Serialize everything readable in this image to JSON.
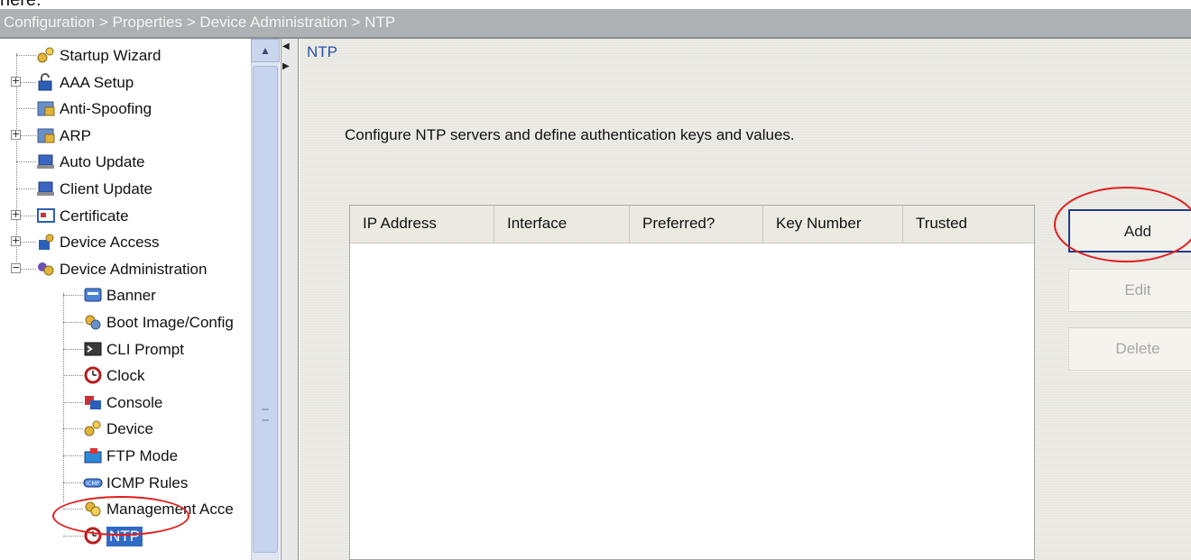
{
  "page_caption": "here:",
  "breadcrumb": "Configuration > Properties > Device Administration > NTP",
  "nav_tree": [
    {
      "label": "Startup Wizard",
      "level": 0,
      "expander": "",
      "icon": "wizard-icon"
    },
    {
      "label": "AAA Setup",
      "level": 0,
      "expander": "+",
      "icon": "aaa-lock-icon"
    },
    {
      "label": "Anti-Spoofing",
      "level": 0,
      "expander": "",
      "icon": "anti-spoofing-icon"
    },
    {
      "label": "ARP",
      "level": 0,
      "expander": "+",
      "icon": "arp-icon"
    },
    {
      "label": "Auto Update",
      "level": 0,
      "expander": "",
      "icon": "auto-update-icon"
    },
    {
      "label": "Client Update",
      "level": 0,
      "expander": "",
      "icon": "client-update-icon"
    },
    {
      "label": "Certificate",
      "level": 0,
      "expander": "+",
      "icon": "certificate-icon"
    },
    {
      "label": "Device Access",
      "level": 0,
      "expander": "+",
      "icon": "device-access-icon"
    },
    {
      "label": "Device Administration",
      "level": 0,
      "expander": "−",
      "icon": "device-administration-icon"
    },
    {
      "label": "Banner",
      "level": 1,
      "expander": "",
      "icon": "banner-icon"
    },
    {
      "label": "Boot Image/Config",
      "level": 1,
      "expander": "",
      "icon": "boot-image-icon"
    },
    {
      "label": "CLI Prompt",
      "level": 1,
      "expander": "",
      "icon": "cli-prompt-icon"
    },
    {
      "label": "Clock",
      "level": 1,
      "expander": "",
      "icon": "clock-icon"
    },
    {
      "label": "Console",
      "level": 1,
      "expander": "",
      "icon": "console-icon"
    },
    {
      "label": "Device",
      "level": 1,
      "expander": "",
      "icon": "device-icon"
    },
    {
      "label": "FTP Mode",
      "level": 1,
      "expander": "",
      "icon": "ftp-mode-icon"
    },
    {
      "label": "ICMP Rules",
      "level": 1,
      "expander": "",
      "icon": "icmp-rules-icon"
    },
    {
      "label": "Management Acce",
      "level": 1,
      "expander": "",
      "icon": "management-access-icon"
    },
    {
      "label": "NTP",
      "level": 1,
      "expander": "",
      "icon": "ntp-clock-icon",
      "selected": true
    }
  ],
  "panel": {
    "title": "NTP",
    "description": "Configure NTP servers and define authentication keys and values."
  },
  "table": {
    "columns": [
      "IP Address",
      "Interface",
      "Preferred?",
      "Key Number",
      "Trusted"
    ],
    "rows": []
  },
  "buttons": {
    "add": "Add",
    "edit": "Edit",
    "delete": "Delete"
  },
  "colors": {
    "annotation": "#e31d1d",
    "selection": "#316ac5",
    "panel_title": "#2b50a8",
    "breadcrumb_bg": "#aeb1b3"
  }
}
